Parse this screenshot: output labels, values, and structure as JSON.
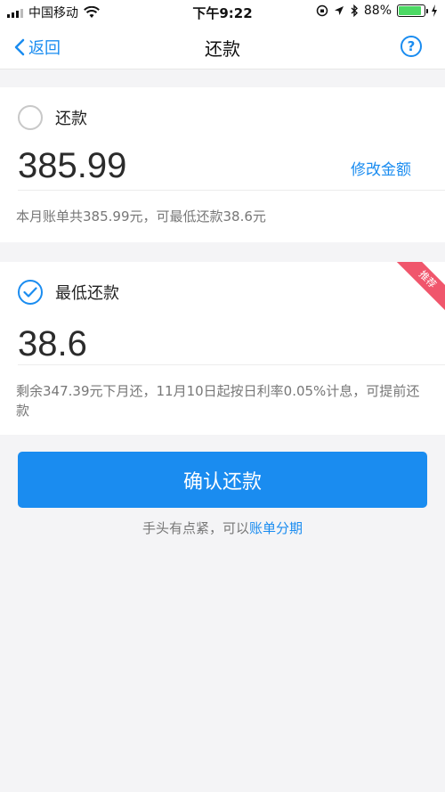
{
  "status_bar": {
    "carrier": "中国移动",
    "time": "下午9:22",
    "battery_percent": "88%",
    "battery_level": 0.88
  },
  "nav": {
    "back_label": "返回",
    "title": "还款",
    "help_icon": "question-circle-icon"
  },
  "full_payment": {
    "label": "还款",
    "amount": "385.99",
    "edit_label": "修改金额",
    "note": "本月账单共385.99元，可最低还款38.6元",
    "selected": false
  },
  "minimum_payment": {
    "label": "最低还款",
    "amount": "38.6",
    "ribbon": "推荐",
    "note": "剩余347.39元下月还，11月10日起按日利率0.05%计息，可提前还款",
    "selected": true
  },
  "confirm_label": "确认还款",
  "hint": {
    "text": "手头有点紧，可以",
    "link": "账单分期"
  },
  "colors": {
    "accent": "#1a8cf0",
    "ribbon": "#f0566c",
    "background": "#f4f4f6"
  }
}
